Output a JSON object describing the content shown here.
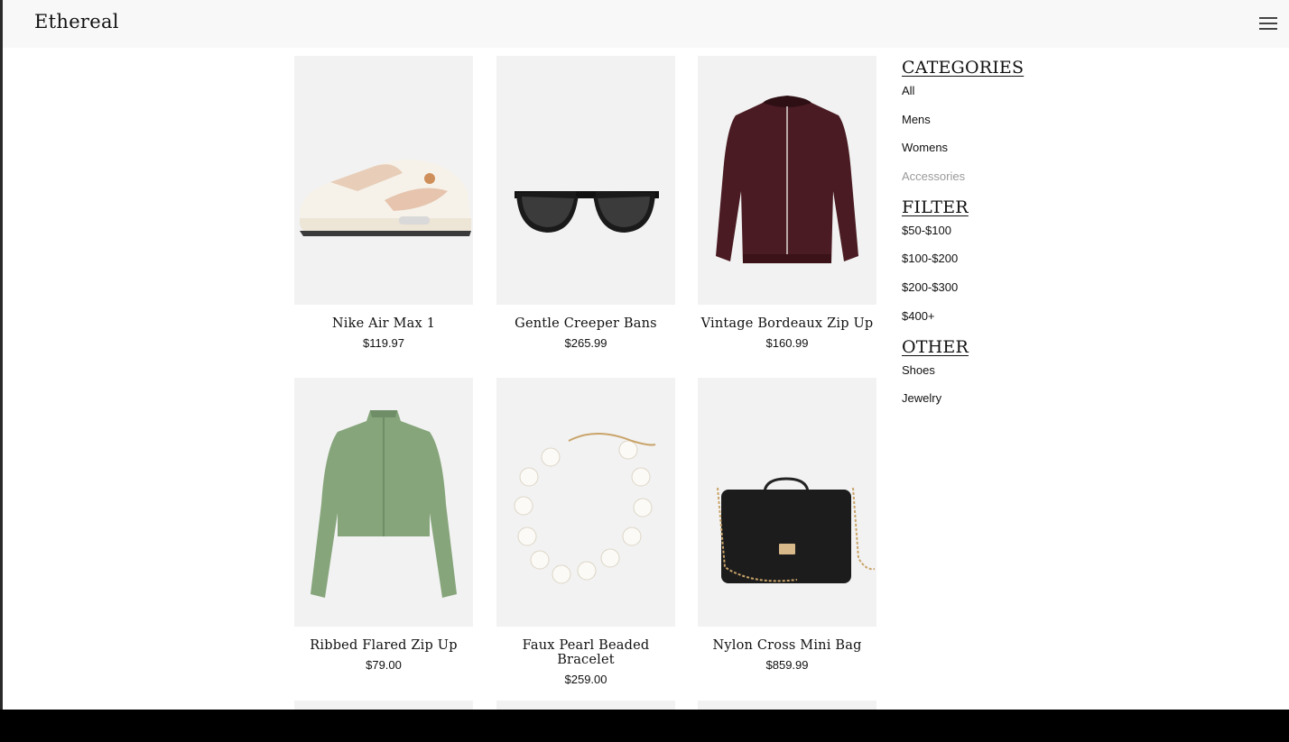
{
  "brand": {
    "name": "Ethereal"
  },
  "products": [
    {
      "name": "Nike Air Max 1",
      "price": "$119.97",
      "image": "sneaker"
    },
    {
      "name": "Gentle Creeper Bans",
      "price": "$265.99",
      "image": "sunglasses"
    },
    {
      "name": "Vintage Bordeaux Zip Up",
      "price": "$160.99",
      "image": "bomber-jacket"
    },
    {
      "name": "Ribbed Flared Zip Up",
      "price": "$79.00",
      "image": "green-zip-top"
    },
    {
      "name": "Faux Pearl Beaded Bracelet",
      "price": "$259.00",
      "image": "pearl-bracelet"
    },
    {
      "name": "Nylon Cross Mini Bag",
      "price": "$859.99",
      "image": "black-bag"
    }
  ],
  "sidebar": {
    "categories": {
      "title": "CATEGORIES",
      "items": [
        "All",
        "Mens",
        "Womens",
        "Accessories"
      ]
    },
    "filter": {
      "title": "FILTER",
      "items": [
        "$50-$100",
        "$100-$200",
        "$200-$300",
        "$400+"
      ]
    },
    "other": {
      "title": "OTHER",
      "items": [
        "Shoes",
        "Jewelry"
      ]
    }
  }
}
